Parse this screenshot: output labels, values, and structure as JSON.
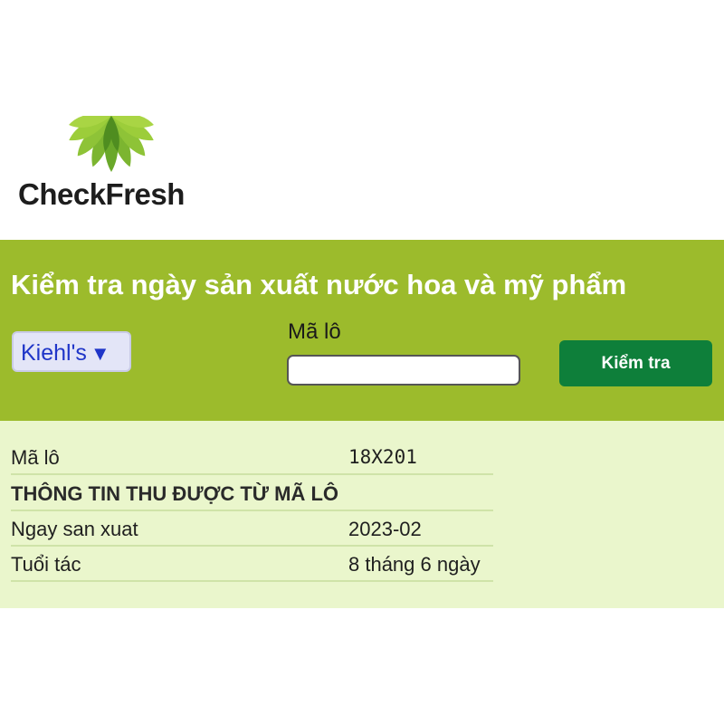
{
  "brand": {
    "name": "CheckFresh",
    "leaf_colors": [
      "#5a9a24",
      "#7cb530",
      "#9ccd3a"
    ]
  },
  "banner": {
    "title": "Kiểm tra ngày sản xuất nước hoa và mỹ phẩm",
    "background": "#9cbb2c"
  },
  "form": {
    "brand_select_value": "Kiehl's",
    "brand_select_arrow": "▼",
    "lot_label": "Mã lô",
    "lot_value": "",
    "submit_label": "Kiểm tra",
    "submit_color": "#0e7f3a"
  },
  "result": {
    "rows": [
      {
        "label": "Mã lô",
        "value": "18X201"
      },
      {
        "label": "THÔNG TIN THU ĐƯỢC TỪ MÃ LÔ",
        "value": ""
      },
      {
        "label": "Ngay san xuat",
        "value": "2023-02"
      },
      {
        "label": "Tuổi tác",
        "value": "8 tháng 6 ngày"
      }
    ],
    "background": "#eaf6cc"
  }
}
